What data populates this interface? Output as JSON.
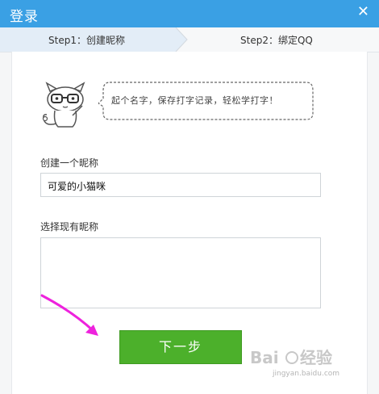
{
  "window": {
    "title": "登录",
    "close_icon": "close-icon"
  },
  "steps": {
    "step1": "Step1：创建昵称",
    "step2": "Step2：绑定QQ",
    "active": 1
  },
  "mascot": {
    "icon": "cat-with-glasses-icon",
    "speech": "起个名字，保存打字记录，轻松学打字！"
  },
  "form": {
    "create_label": "创建一个昵称",
    "create_value": "可爱的小猫咪",
    "existing_label": "选择现有昵称",
    "existing_value": ""
  },
  "actions": {
    "next_label": "下一步",
    "button_color": "#4cb02b"
  },
  "annotation": {
    "arrow_icon": "magenta-arrow-icon",
    "color": "#ee22dd"
  },
  "watermark": {
    "brand": "Baidu经验",
    "url": "jingyan.baidu.com"
  }
}
